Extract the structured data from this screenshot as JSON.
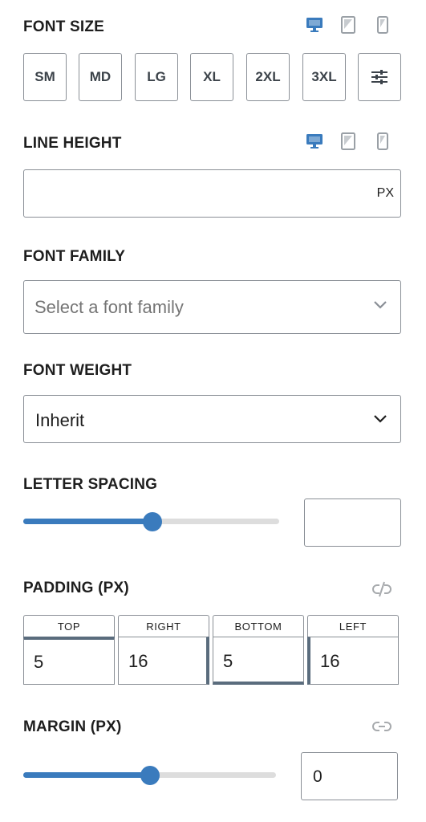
{
  "font_size": {
    "label": "FONT SIZE",
    "sizes": [
      "SM",
      "MD",
      "LG",
      "XL",
      "2XL",
      "3XL"
    ],
    "custom_icon": "sliders-icon"
  },
  "devices": [
    "desktop-icon",
    "tablet-icon",
    "mobile-icon"
  ],
  "line_height": {
    "label": "LINE HEIGHT",
    "value": "",
    "unit": "PX"
  },
  "font_family": {
    "label": "FONT FAMILY",
    "placeholder": "Select a font family"
  },
  "font_weight": {
    "label": "FONT WEIGHT",
    "value": "Inherit"
  },
  "letter_spacing": {
    "label": "LETTER SPACING",
    "value": "",
    "slider_fraction": 0.5
  },
  "padding": {
    "label": "PADDING (PX)",
    "link_icon": "unlink-icon",
    "sides": [
      {
        "label": "TOP",
        "value": "5"
      },
      {
        "label": "RIGHT",
        "value": "16"
      },
      {
        "label": "BOTTOM",
        "value": "5"
      },
      {
        "label": "LEFT",
        "value": "16"
      }
    ]
  },
  "margin": {
    "label": "MARGIN (PX)",
    "link_icon": "link-icon",
    "value": "0",
    "slider_fraction": 0.5
  },
  "colors": {
    "accent": "#3a7bbd",
    "border": "#8a8f96",
    "track": "#dddddd",
    "inactive_icon": "#9aa0a6"
  }
}
